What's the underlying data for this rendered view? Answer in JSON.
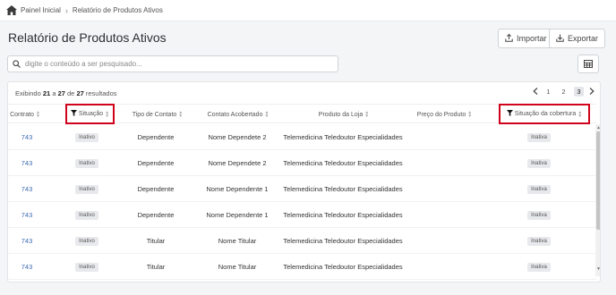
{
  "breadcrumb": {
    "home": "Painel Inicial",
    "current": "Relatório de Produtos Ativos"
  },
  "page": {
    "title": "Relatório de Produtos Ativos"
  },
  "actions": {
    "import_label": "Importar",
    "export_label": "Exportar"
  },
  "search": {
    "placeholder": "digite o conteúdo a ser pesquisado..."
  },
  "summary": {
    "prefix": "Exibindo",
    "from": "21",
    "mid": "a",
    "to": "27",
    "of": "de",
    "total": "27",
    "suffix": "resultados"
  },
  "pagination": {
    "pages": [
      "1",
      "2",
      "3"
    ],
    "current": "3"
  },
  "columns": {
    "contrato": "Contrato",
    "situacao": "Situação",
    "tipo": "Tipo de Contato",
    "acobertado": "Contato Acobertado",
    "produto": "Produto da Loja",
    "preco": "Preço do Produto",
    "cobertura": "Situação da cobertura"
  },
  "rows": [
    {
      "contrato": "743",
      "situacao": "Inativo",
      "tipo": "Dependente",
      "acobertado": "Nome Dependete 2",
      "produto": "Telemedicina Teledoutor Especialidades",
      "preco": "",
      "cobertura": "Inativa"
    },
    {
      "contrato": "743",
      "situacao": "Inativo",
      "tipo": "Dependente",
      "acobertado": "Nome Dependete 2",
      "produto": "Telemedicina Teledoutor Especialidades",
      "preco": "",
      "cobertura": "Inativa"
    },
    {
      "contrato": "743",
      "situacao": "Inativo",
      "tipo": "Dependente",
      "acobertado": "Nome Dependente 1",
      "produto": "Telemedicina Teledoutor Especialidades",
      "preco": "",
      "cobertura": "Inativa"
    },
    {
      "contrato": "743",
      "situacao": "Inativo",
      "tipo": "Dependente",
      "acobertado": "Nome Dependente 1",
      "produto": "Telemedicina Teledoutor Especialidades",
      "preco": "",
      "cobertura": "Inativa"
    },
    {
      "contrato": "743",
      "situacao": "Inativo",
      "tipo": "Titular",
      "acobertado": "Nome Titular",
      "produto": "Telemedicina Teledoutor Especialidades",
      "preco": "",
      "cobertura": "Inativa"
    },
    {
      "contrato": "743",
      "situacao": "Inativo",
      "tipo": "Titular",
      "acobertado": "Nome Titular",
      "produto": "Telemedicina Teledoutor Especialidades",
      "preco": "",
      "cobertura": "Inativa"
    }
  ],
  "colors": {
    "link": "#3d6bb3",
    "highlight": "#d0021b"
  }
}
